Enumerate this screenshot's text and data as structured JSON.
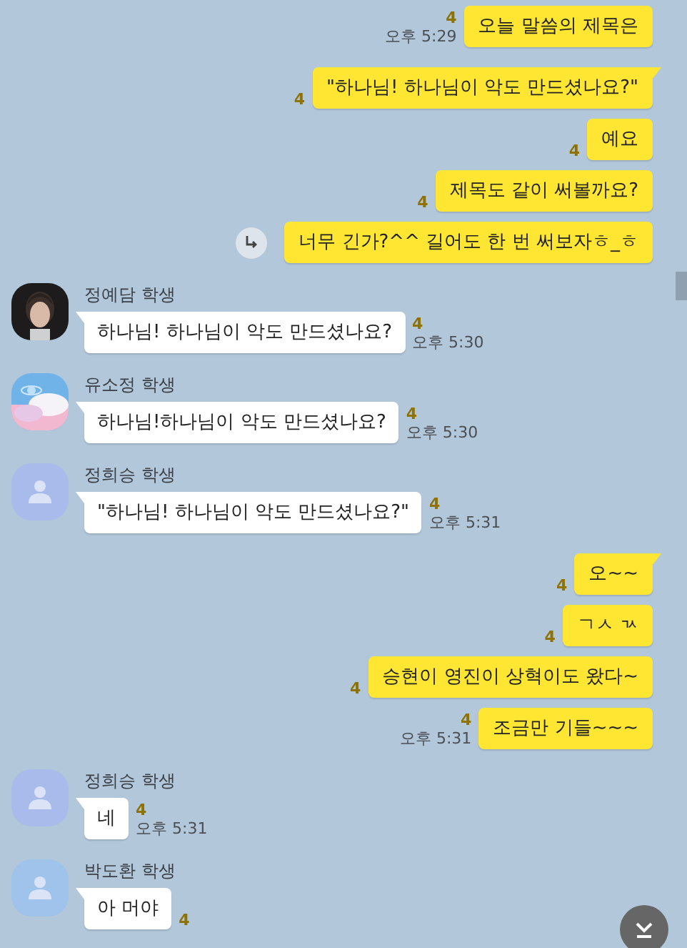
{
  "messages": [
    {
      "kind": "sent",
      "bubbles": [
        {
          "text": "오늘 말씀의 제목은",
          "unread": "4",
          "time": "오후 5:29",
          "tail": false
        }
      ]
    },
    {
      "kind": "sent",
      "bubbles": [
        {
          "text": "\"하나님! 하나님이 악도 만드셨나요?\"",
          "unread": "4",
          "tail": true
        },
        {
          "text": "예요",
          "unread": "4",
          "tail": false
        },
        {
          "text": "제목도 같이 써볼까요?",
          "unread": "4",
          "tail": false
        },
        {
          "text": "너무 긴가?^^ 길어도 한 번 써보자ㅎ_ㅎ",
          "share": true,
          "tail": false
        }
      ]
    },
    {
      "kind": "received",
      "sender": "정예담 학생",
      "bubbles": [
        {
          "text": "하나님! 하나님이 악도 만드셨나요?",
          "unread": "4",
          "time": "오후 5:30"
        }
      ]
    },
    {
      "kind": "received",
      "sender": "유소정 학생",
      "bubbles": [
        {
          "text": "하나님!하나님이 악도 만드셨나요?",
          "unread": "4",
          "time": "오후 5:30"
        }
      ]
    },
    {
      "kind": "received",
      "sender": "정희승 학생",
      "avatar": {
        "kind": "default",
        "color": "#a9bbea"
      },
      "bubbles": [
        {
          "text": "\"하나님! 하나님이 악도 만드셨나요?\"",
          "unread": "4",
          "time": "오후 5:31"
        }
      ]
    },
    {
      "kind": "sent",
      "bubbles": [
        {
          "text": "오~~",
          "unread": "4",
          "tail": true
        },
        {
          "text": "ㄱㅅ ㄳ",
          "unread": "4",
          "tail": false
        },
        {
          "text": "승현이 영진이 상혁이도 왔다~",
          "unread": "4",
          "tail": false
        },
        {
          "text": "조금만 기들~~~",
          "unread": "4",
          "time": "오후 5:31",
          "tail": false
        }
      ]
    },
    {
      "kind": "received",
      "sender": "정희승 학생",
      "avatar": {
        "kind": "default",
        "color": "#a9bbea"
      },
      "bubbles": [
        {
          "text": "네",
          "unread": "4",
          "time": "오후 5:31"
        }
      ]
    },
    {
      "kind": "received",
      "sender": "박도환 학생",
      "avatar": {
        "kind": "default",
        "color": "#9fc3ea"
      },
      "bubbles": [
        {
          "text": "아 머야",
          "unread": "4"
        }
      ]
    }
  ]
}
